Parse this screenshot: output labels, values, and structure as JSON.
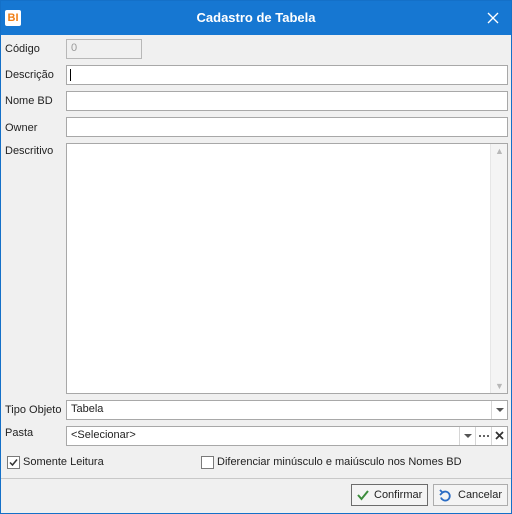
{
  "window": {
    "title": "Cadastro de Tabela",
    "logo_text": "BI"
  },
  "form": {
    "codigo": {
      "label": "Código",
      "value": "0"
    },
    "descricao": {
      "label": "Descrição",
      "value": ""
    },
    "nome_bd": {
      "label": "Nome BD",
      "value": ""
    },
    "owner": {
      "label": "Owner",
      "value": ""
    },
    "descritivo": {
      "label": "Descritivo",
      "value": ""
    },
    "tipo_objeto": {
      "label": "Tipo Objeto",
      "value": "Tabela"
    },
    "pasta": {
      "label": "Pasta",
      "value": "<Selecionar>"
    }
  },
  "options": {
    "somente_leitura": {
      "label": "Somente Leitura",
      "checked": true
    },
    "diferenciar": {
      "label": "Diferenciar minúsculo e maiúsculo nos Nomes BD",
      "checked": false
    }
  },
  "buttons": {
    "confirmar": "Confirmar",
    "cancelar": "Cancelar"
  },
  "colors": {
    "titlebar": "#1677d2",
    "accent": "#f07f16",
    "confirm_check": "#3c8c3c"
  }
}
